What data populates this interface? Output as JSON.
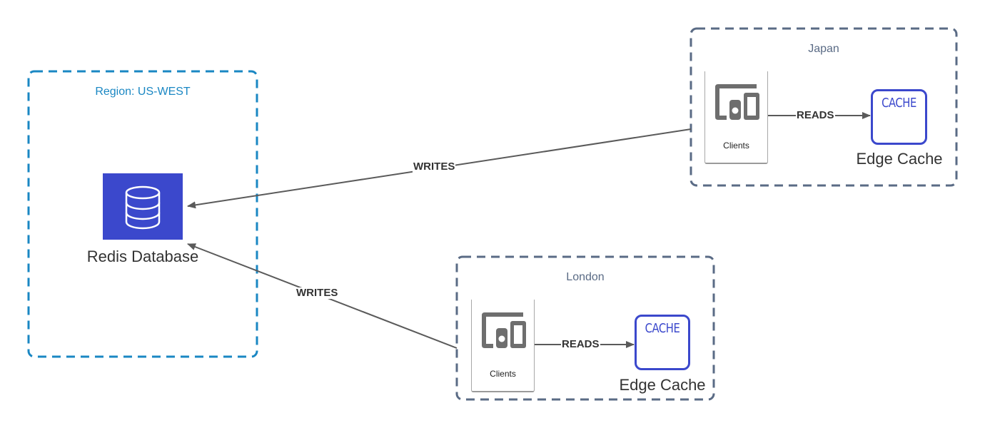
{
  "diagram": {
    "colors": {
      "us_west_border": "#1a87c3",
      "region_border": "#5a6b85",
      "db_fill": "#3b48cc",
      "cache_accent": "#3b48cc",
      "connector": "#5a5a5a",
      "device_icon": "#6e6e6e"
    },
    "regions": {
      "us_west": {
        "label": "Region: US-WEST"
      },
      "japan": {
        "label": "Japan"
      },
      "london": {
        "label": "London"
      }
    },
    "nodes": {
      "redis": {
        "label": "Redis Database",
        "icon": "database-icon"
      },
      "japan_clients": {
        "label": "Clients",
        "icon": "devices-icon"
      },
      "japan_cache": {
        "badge": "CACHE",
        "label": "Edge Cache"
      },
      "london_clients": {
        "label": "Clients",
        "icon": "devices-icon"
      },
      "london_cache": {
        "badge": "CACHE",
        "label": "Edge Cache"
      }
    },
    "edges": [
      {
        "from": "japan",
        "to": "redis",
        "label": "WRITES"
      },
      {
        "from": "london",
        "to": "redis",
        "label": "WRITES"
      },
      {
        "from": "japan_clients",
        "to": "japan_cache",
        "label": "READS"
      },
      {
        "from": "london_clients",
        "to": "london_cache",
        "label": "READS"
      }
    ]
  }
}
